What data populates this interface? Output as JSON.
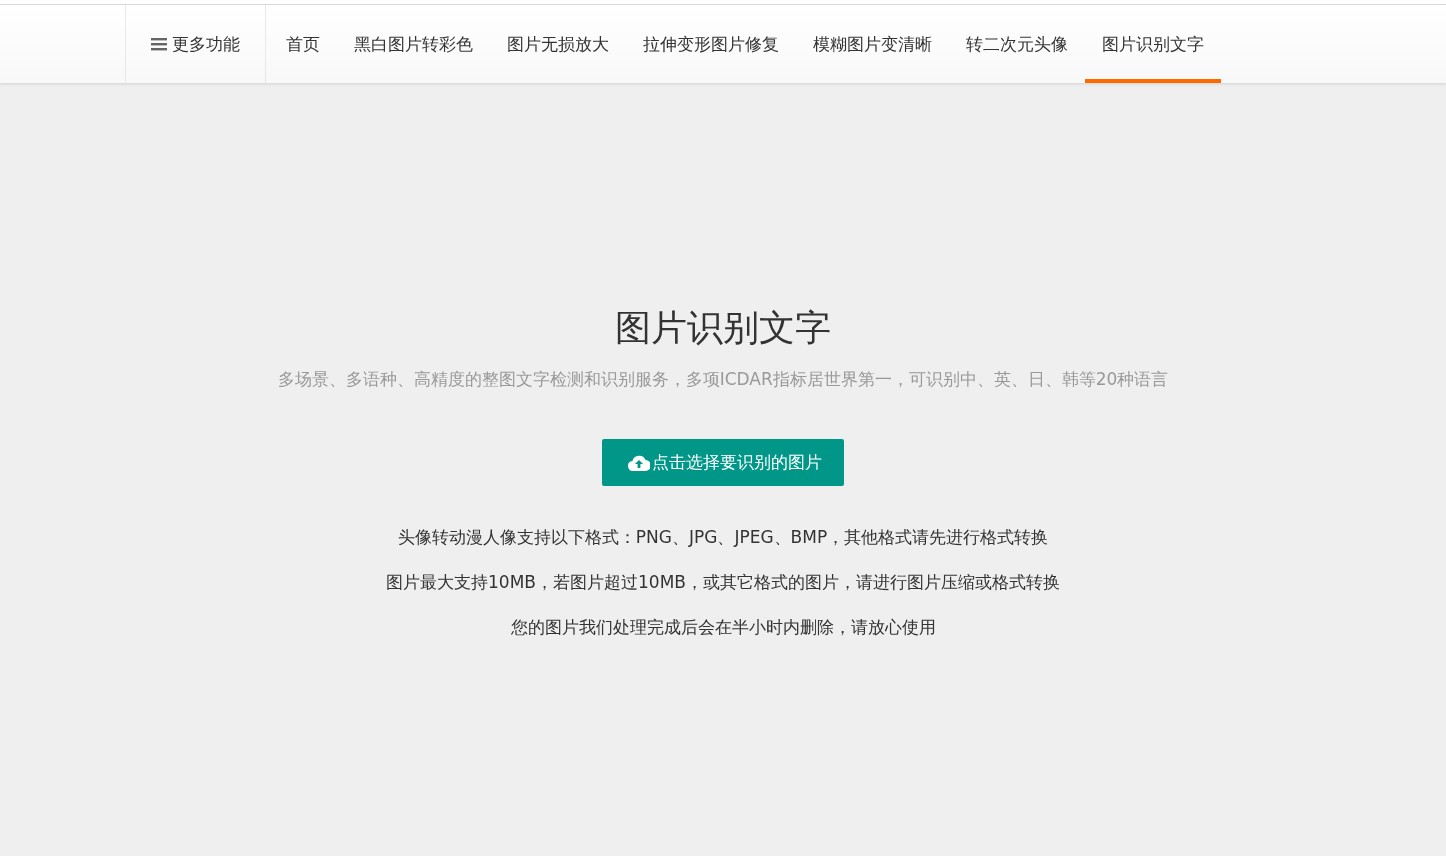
{
  "nav": {
    "menu": {
      "label": "更多功能"
    },
    "items": [
      {
        "label": "首页",
        "selected": false
      },
      {
        "label": "黑白图片转彩色",
        "selected": false
      },
      {
        "label": "图片无损放大",
        "selected": false
      },
      {
        "label": "拉伸变形图片修复",
        "selected": false
      },
      {
        "label": "模糊图片变清晰",
        "selected": false
      },
      {
        "label": "转二次元头像",
        "selected": false
      },
      {
        "label": "图片识别文字",
        "selected": true
      }
    ]
  },
  "main": {
    "title": "图片识别文字",
    "subtitle": "多场景、多语种、高精度的整图文字检测和识别服务，多项ICDAR指标居世界第一，可识别中、英、日、韩等20种语言",
    "upload_button": "点击选择要识别的图片",
    "notes": [
      "头像转动漫人像支持以下格式：PNG、JPG、JPEG、BMP，其他格式请先进行格式转换",
      "图片最大支持10MB，若图片超过10MB，或其它格式的图片，请进行图片压缩或格式转换",
      "您的图片我们处理完成后会在半小时内删除，请放心使用"
    ]
  }
}
